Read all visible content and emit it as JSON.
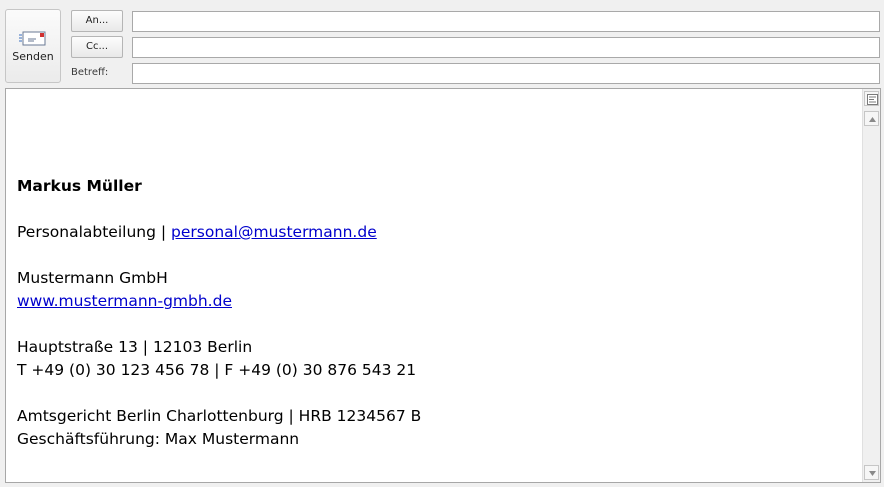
{
  "compose": {
    "send_label": "Senden",
    "to_label": "An...",
    "cc_label": "Cc...",
    "subject_label": "Betreff:",
    "to_value": "",
    "cc_value": "",
    "subject_value": ""
  },
  "signature": {
    "name": "Markus Müller",
    "department": "Personalabteilung",
    "separator": " | ",
    "email": "personal@mustermann.de",
    "company": "Mustermann GmbH",
    "website": "www.mustermann-gmbh.de",
    "address": "Hauptstraße 13 | 12103 Berlin",
    "phone": "T +49 (0) 30 123 456 78 | F +49 (0) 30 876 543 21",
    "court": "Amtsgericht Berlin Charlottenburg | HRB 1234567 B",
    "ceo": "Geschäftsführung: Max Mustermann"
  },
  "colors": {
    "link": "#0000cc",
    "chrome": "#f0f0f0"
  },
  "icons": {
    "send": "envelope-icon",
    "ruler": "ruler-icon",
    "scroll_up": "arrow-up-icon",
    "scroll_down": "arrow-down-icon"
  }
}
